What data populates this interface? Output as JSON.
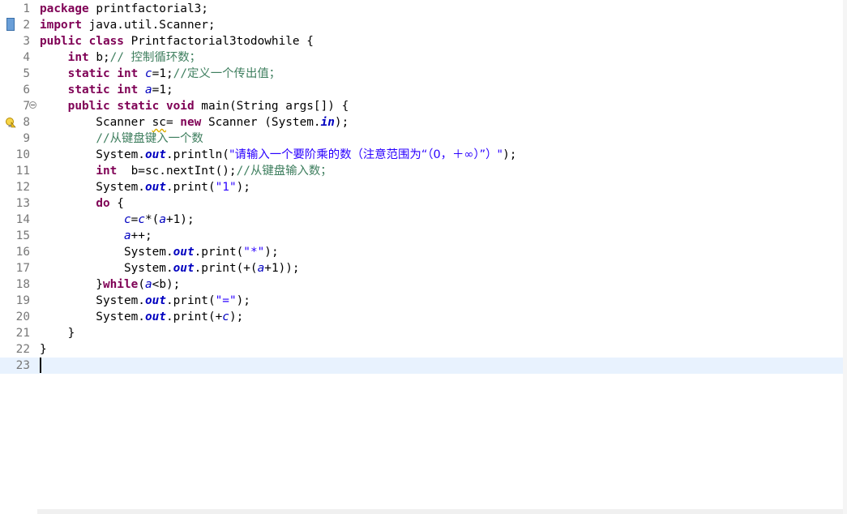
{
  "editor": {
    "lines": [
      {
        "num": "1",
        "segments": [
          [
            "kw",
            "package"
          ],
          [
            "plain",
            " printfactorial3;"
          ]
        ]
      },
      {
        "num": "2",
        "segments": [
          [
            "kw",
            "import"
          ],
          [
            "plain",
            " java.util.Scanner;"
          ]
        ]
      },
      {
        "num": "3",
        "segments": [
          [
            "kw",
            "public"
          ],
          [
            "plain",
            " "
          ],
          [
            "kw",
            "class"
          ],
          [
            "plain",
            " Printfactorial3todowhile {"
          ]
        ]
      },
      {
        "num": "4",
        "segments": [
          [
            "plain",
            "    "
          ],
          [
            "kw",
            "int"
          ],
          [
            "plain",
            " b;"
          ],
          [
            "cmt",
            "// "
          ],
          [
            "cmtcjk",
            "控制循环数；"
          ]
        ]
      },
      {
        "num": "5",
        "segments": [
          [
            "plain",
            "    "
          ],
          [
            "kw",
            "static"
          ],
          [
            "plain",
            " "
          ],
          [
            "kw",
            "int"
          ],
          [
            "plain",
            " "
          ],
          [
            "fld",
            "c"
          ],
          [
            "plain",
            "=1;"
          ],
          [
            "cmt",
            "//"
          ],
          [
            "cmtcjk",
            "定义一个传出值；"
          ]
        ]
      },
      {
        "num": "6",
        "segments": [
          [
            "plain",
            "    "
          ],
          [
            "kw",
            "static"
          ],
          [
            "plain",
            " "
          ],
          [
            "kw",
            "int"
          ],
          [
            "plain",
            " "
          ],
          [
            "fld",
            "a"
          ],
          [
            "plain",
            "=1;"
          ]
        ]
      },
      {
        "num": "7",
        "segments": [
          [
            "plain",
            "    "
          ],
          [
            "kw",
            "public"
          ],
          [
            "plain",
            " "
          ],
          [
            "kw",
            "static"
          ],
          [
            "plain",
            " "
          ],
          [
            "kw",
            "void"
          ],
          [
            "plain",
            " main(String args[]) {"
          ]
        ]
      },
      {
        "num": "8",
        "segments": [
          [
            "plain",
            "        Scanner "
          ],
          [
            "unused",
            "sc"
          ],
          [
            "plain",
            "= "
          ],
          [
            "kw",
            "new"
          ],
          [
            "plain",
            " Scanner (System."
          ],
          [
            "sfld",
            "in"
          ],
          [
            "plain",
            ");"
          ]
        ]
      },
      {
        "num": "9",
        "segments": [
          [
            "plain",
            "        "
          ],
          [
            "cmt",
            "//"
          ],
          [
            "cmtcjk",
            "从键盘键入一个数"
          ]
        ]
      },
      {
        "num": "10",
        "segments": [
          [
            "plain",
            "        System."
          ],
          [
            "sfld",
            "out"
          ],
          [
            "plain",
            ".println("
          ],
          [
            "strcjk",
            "\"请输入一个要阶乘的数（注意范围为“（0，＋∞）”）\""
          ],
          [
            "plain",
            ");"
          ]
        ]
      },
      {
        "num": "11",
        "segments": [
          [
            "plain",
            "        "
          ],
          [
            "kw",
            "int"
          ],
          [
            "plain",
            "  b=sc.nextInt();"
          ],
          [
            "cmt",
            "//"
          ],
          [
            "cmtcjk",
            "从键盘输入数；"
          ]
        ]
      },
      {
        "num": "12",
        "segments": [
          [
            "plain",
            "        System."
          ],
          [
            "sfld",
            "out"
          ],
          [
            "plain",
            ".print("
          ],
          [
            "str",
            "\"1\""
          ],
          [
            "plain",
            ");"
          ]
        ]
      },
      {
        "num": "13",
        "segments": [
          [
            "plain",
            "        "
          ],
          [
            "kw",
            "do"
          ],
          [
            "plain",
            " {"
          ]
        ]
      },
      {
        "num": "14",
        "segments": [
          [
            "plain",
            "            "
          ],
          [
            "fld",
            "c"
          ],
          [
            "plain",
            "="
          ],
          [
            "fld",
            "c"
          ],
          [
            "plain",
            "*("
          ],
          [
            "fld",
            "a"
          ],
          [
            "plain",
            "+1);"
          ]
        ]
      },
      {
        "num": "15",
        "segments": [
          [
            "plain",
            "            "
          ],
          [
            "fld",
            "a"
          ],
          [
            "plain",
            "++;"
          ]
        ]
      },
      {
        "num": "16",
        "segments": [
          [
            "plain",
            "            System."
          ],
          [
            "sfld",
            "out"
          ],
          [
            "plain",
            ".print("
          ],
          [
            "str",
            "\"*\""
          ],
          [
            "plain",
            ");"
          ]
        ]
      },
      {
        "num": "17",
        "segments": [
          [
            "plain",
            "            System."
          ],
          [
            "sfld",
            "out"
          ],
          [
            "plain",
            ".print(+("
          ],
          [
            "fld",
            "a"
          ],
          [
            "plain",
            "+1));"
          ]
        ]
      },
      {
        "num": "18",
        "segments": [
          [
            "plain",
            "        }"
          ],
          [
            "kw",
            "while"
          ],
          [
            "plain",
            "("
          ],
          [
            "fld",
            "a"
          ],
          [
            "plain",
            "<b);"
          ]
        ]
      },
      {
        "num": "19",
        "segments": [
          [
            "plain",
            "        System."
          ],
          [
            "sfld",
            "out"
          ],
          [
            "plain",
            ".print("
          ],
          [
            "str",
            "\"=\""
          ],
          [
            "plain",
            ");"
          ]
        ]
      },
      {
        "num": "20",
        "segments": [
          [
            "plain",
            "        System."
          ],
          [
            "sfld",
            "out"
          ],
          [
            "plain",
            ".print(+"
          ],
          [
            "fld",
            "c"
          ],
          [
            "plain",
            ");"
          ]
        ]
      },
      {
        "num": "21",
        "segments": [
          [
            "plain",
            "    }"
          ]
        ]
      },
      {
        "num": "22",
        "segments": [
          [
            "plain",
            "}"
          ]
        ]
      },
      {
        "num": "23",
        "segments": [
          [
            "plain",
            ""
          ]
        ]
      }
    ],
    "current_line": 23,
    "icons": {
      "bookmark": "bookmark-marker-icon",
      "warning": "warning-lightbulb-icon",
      "fold": "fold-collapse-icon"
    },
    "colors": {
      "keyword": "#7f0055",
      "string": "#2a00ff",
      "comment": "#3f7f5f",
      "field": "#0000c0",
      "current_line_bg": "#e8f2fe"
    }
  }
}
